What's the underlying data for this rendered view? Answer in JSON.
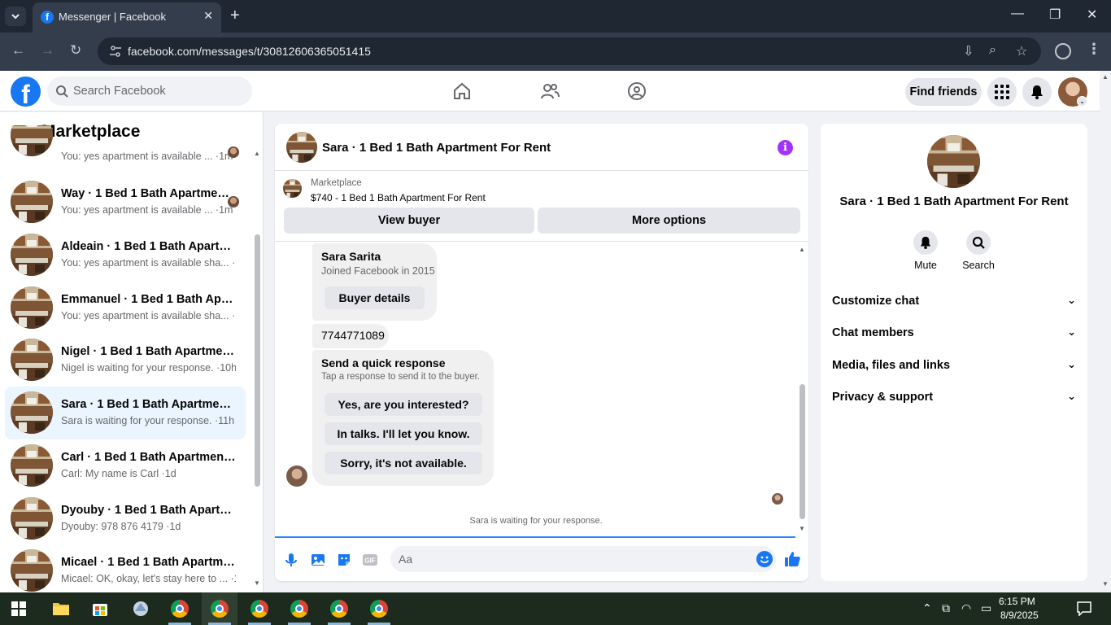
{
  "browser": {
    "tab_title": "Messenger | Facebook",
    "url": "facebook.com/messages/t/30812606365051415"
  },
  "fb_header": {
    "search_placeholder": "Search Facebook",
    "find_friends_label": "Find friends"
  },
  "sidebar": {
    "title": "Marketplace",
    "conversations": [
      {
        "name": "",
        "preview": "You: yes apartment is available ... ·1m"
      },
      {
        "name": "Way · 1 Bed 1 Bath Apartment...",
        "preview": "You: yes apartment is available ... ·1m"
      },
      {
        "name": "Aldeain · 1 Bed 1 Bath Apartmen...",
        "preview": "You: yes apartment is available sha... ·1m"
      },
      {
        "name": "Emmanuel · 1 Bed 1 Bath Apart...",
        "preview": "You: yes apartment is available sha... ·1m"
      },
      {
        "name": "Nigel · 1 Bed 1 Bath Apartment F...",
        "preview": "Nigel is waiting for your response. ·10h"
      },
      {
        "name": "Sara · 1 Bed 1 Bath Apartment F...",
        "preview": "Sara is waiting for your response. ·11h"
      },
      {
        "name": "Carl · 1 Bed 1 Bath Apartment Fo...",
        "preview": "Carl: My name is Carl ·1d"
      },
      {
        "name": "Dyouby · 1 Bed 1 Bath Apartmen...",
        "preview": "Dyouby: 978 876 4179 ·1d"
      },
      {
        "name": "Micael · 1 Bed 1 Bath Apartment...",
        "preview": "Micael: OK, okay, let's stay here to ... ·1d"
      }
    ]
  },
  "chat": {
    "title": "Sara · 1 Bed 1 Bath Apartment For Rent",
    "marketplace_label": "Marketplace",
    "listing": "$740 - 1 Bed 1 Bath Apartment For Rent",
    "view_buyer_label": "View buyer",
    "more_options_label": "More options",
    "buyer_card": {
      "name": "Sara Sarita",
      "joined": "Joined Facebook in 2015",
      "button": "Buyer details"
    },
    "phone_message": "7744771089",
    "quick_response": {
      "title": "Send a quick response",
      "subtitle": "Tap a response to send it to the buyer.",
      "options": [
        "Yes, are you interested?",
        "In talks. I'll let you know.",
        "Sorry, it's not available."
      ]
    },
    "waiting_text": "Sara is waiting for your response.",
    "input_placeholder": "Aa"
  },
  "info_panel": {
    "name": "Sara · 1 Bed 1 Bath Apartment For Rent",
    "mute_label": "Mute",
    "search_label": "Search",
    "sections": [
      "Customize chat",
      "Chat members",
      "Media, files and links",
      "Privacy & support"
    ]
  },
  "taskbar": {
    "time": "6:15 PM",
    "date": "8/9/2025"
  },
  "colors": {
    "fb_blue": "#1877f2",
    "info_purple": "#a033ff",
    "selected_row": "#ebf5ff"
  }
}
